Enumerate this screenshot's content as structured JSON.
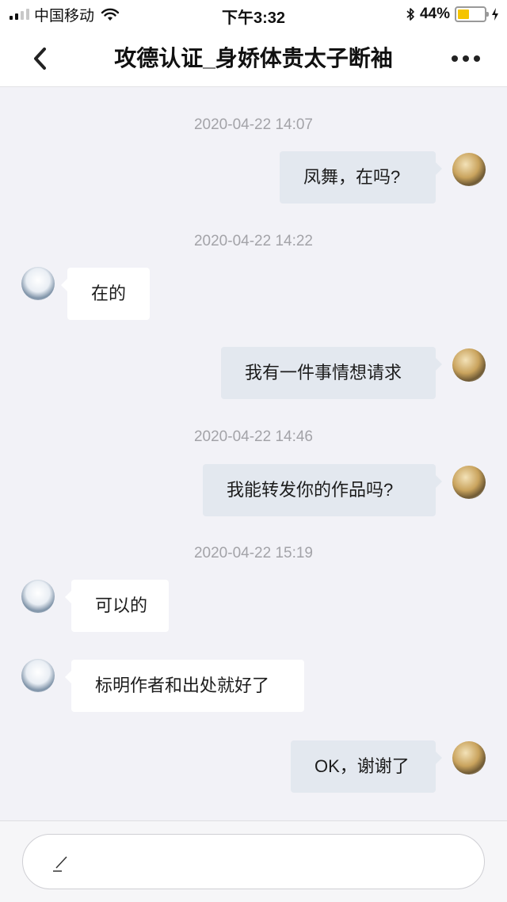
{
  "status_bar": {
    "carrier": "中国移动",
    "time": "下午3:32",
    "battery": "44%",
    "battery_level": 0.44
  },
  "nav": {
    "title": "攻德认证_身娇体贵太子断袖"
  },
  "input": {
    "placeholder": ""
  },
  "timestamps": [
    "2020-04-22 14:07",
    "2020-04-22 14:22",
    "2020-04-22 14:46",
    "2020-04-22 15:19"
  ],
  "messages": [
    {
      "from": "me",
      "text": "凤舞，在吗?"
    },
    {
      "from": "other",
      "text": "在的"
    },
    {
      "from": "me",
      "text": "我有一件事情想请求"
    },
    {
      "from": "me",
      "text": "我能转发你的作品吗?"
    },
    {
      "from": "other",
      "text": "可以的"
    },
    {
      "from": "other",
      "text": "标明作者和出处就好了"
    },
    {
      "from": "me",
      "text": "OK，谢谢了"
    }
  ],
  "colors": {
    "chat_background": "#f2f2f7",
    "bubble_me": "#e3e8ef",
    "bubble_other": "#ffffff",
    "timestamp": "#a3a3a8",
    "battery_fill": "#f5c400"
  }
}
